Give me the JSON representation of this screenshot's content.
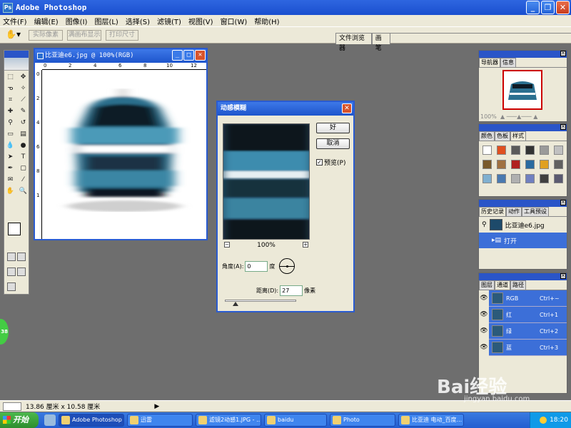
{
  "app": {
    "title": "Adobe Photoshop",
    "window_buttons": {
      "minimize": "_",
      "restore": "❐",
      "close": "✕"
    }
  },
  "menu": [
    "文件(F)",
    "编辑(E)",
    "图像(I)",
    "图层(L)",
    "选择(S)",
    "滤镜(T)",
    "视图(V)",
    "窗口(W)",
    "帮助(H)"
  ],
  "options_bar": {
    "tool_icon": "hand-icon",
    "buttons": [
      "实际像素",
      "满画布显示",
      "打印尺寸"
    ],
    "palette_well_tabs": [
      "文件浏览器",
      "画笔"
    ]
  },
  "document": {
    "title": "比亚迪e6.jpg @ 100%(RGB)",
    "ruler_top": [
      "0",
      "2",
      "4",
      "6",
      "8",
      "10",
      "12"
    ],
    "ruler_left": [
      "0",
      "2",
      "4",
      "6",
      "8",
      "1"
    ]
  },
  "motion_blur_dialog": {
    "title": "动感模糊",
    "ok": "好",
    "cancel": "取消",
    "preview_label": "预览(P)",
    "preview_checked": "✓",
    "zoom": "100%",
    "zoom_out": "−",
    "zoom_in": "+",
    "angle_label": "角度(A):",
    "angle_value": "0",
    "angle_unit": "度",
    "distance_label": "距离(D):",
    "distance_value": "27",
    "distance_unit": "像素"
  },
  "navigator": {
    "tabs": [
      "导航器",
      "信息"
    ],
    "zoom": "100%"
  },
  "styles": {
    "tabs": [
      "颜色",
      "色板",
      "样式"
    ],
    "swatch_colors": [
      "#ffffff",
      "#e05020",
      "#5a5a5a",
      "#333333",
      "#9a9a9a",
      "#c0c0c0",
      "#7a5a2a",
      "#a07040",
      "#b02020",
      "#2a6aa0",
      "#e0a020",
      "#606060",
      "#80b0d0",
      "#4a7ab0",
      "#b0b0b0",
      "#7080c0",
      "#404040",
      "#5a5a70"
    ]
  },
  "history": {
    "tabs": [
      "历史记录",
      "动作",
      "工具预设"
    ],
    "snapshot": "比亚迪e6.jpg",
    "open_state": "打开"
  },
  "channels": {
    "tabs": [
      "图层",
      "通道",
      "路径"
    ],
    "rows": [
      {
        "name": "RGB",
        "shortcut": "Ctrl+~"
      },
      {
        "name": "红",
        "shortcut": "Ctrl+1"
      },
      {
        "name": "绿",
        "shortcut": "Ctrl+2"
      },
      {
        "name": "蓝",
        "shortcut": "Ctrl+3"
      }
    ]
  },
  "status": {
    "size": "13.86 厘米 x 10.58 厘米"
  },
  "taskbar": {
    "start": "开始",
    "tasks": [
      "Adobe Photoshop",
      "迅雷",
      "滤镜2动感1.JPG - ...",
      "baidu",
      "Photo",
      "比亚迪 电动_百度..."
    ],
    "clock": "18:20"
  },
  "overlay": {
    "badge": "38",
    "watermark": "Bai经验",
    "watermark_url": "jingyan.baidu.com"
  }
}
